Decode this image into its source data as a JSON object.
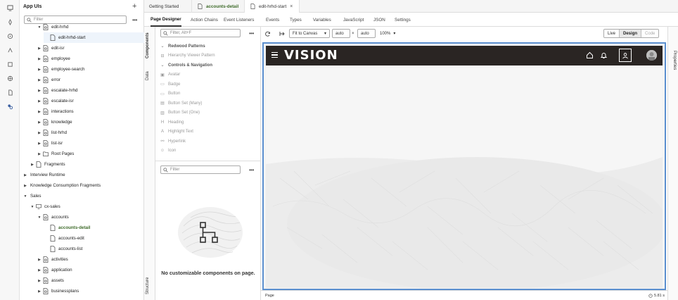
{
  "navigator": {
    "title": "App UIs",
    "filter_placeholder": "Filter",
    "tree": [
      {
        "label": "edit-hrhd",
        "depth": 3,
        "caret": "open",
        "icon": "flow"
      },
      {
        "label": "edit-hrhd-start",
        "depth": 4,
        "caret": "none",
        "icon": "page",
        "selected": true
      },
      {
        "label": "edit-isr",
        "depth": 3,
        "caret": "closed",
        "icon": "flow"
      },
      {
        "label": "employee",
        "depth": 3,
        "caret": "closed",
        "icon": "flow"
      },
      {
        "label": "employee-search",
        "depth": 3,
        "caret": "closed",
        "icon": "flow"
      },
      {
        "label": "error",
        "depth": 3,
        "caret": "closed",
        "icon": "flow"
      },
      {
        "label": "escalate-hrhd",
        "depth": 3,
        "caret": "closed",
        "icon": "flow"
      },
      {
        "label": "escalate-isr",
        "depth": 3,
        "caret": "closed",
        "icon": "flow"
      },
      {
        "label": "interactions",
        "depth": 3,
        "caret": "closed",
        "icon": "flow"
      },
      {
        "label": "knowledge",
        "depth": 3,
        "caret": "closed",
        "icon": "flow"
      },
      {
        "label": "list-hrhd",
        "depth": 3,
        "caret": "closed",
        "icon": "flow"
      },
      {
        "label": "list-isr",
        "depth": 3,
        "caret": "closed",
        "icon": "flow"
      },
      {
        "label": "Root Pages",
        "depth": 3,
        "caret": "closed",
        "icon": "folder"
      },
      {
        "label": "Fragments",
        "depth": 2,
        "caret": "closed",
        "icon": "page"
      },
      {
        "label": "Interview Runtime",
        "depth": 1,
        "caret": "closed",
        "icon": "none"
      },
      {
        "label": "Knowledge Consumption Fragments",
        "depth": 1,
        "caret": "closed",
        "icon": "none"
      },
      {
        "label": "Sales",
        "depth": 1,
        "caret": "open",
        "icon": "none"
      },
      {
        "label": "cx-sales",
        "depth": 2,
        "caret": "open",
        "icon": "app"
      },
      {
        "label": "accounts",
        "depth": 3,
        "caret": "open",
        "icon": "flow"
      },
      {
        "label": "accounts-detail",
        "depth": 4,
        "caret": "none",
        "icon": "page",
        "active": true
      },
      {
        "label": "accounts-edit",
        "depth": 4,
        "caret": "none",
        "icon": "page"
      },
      {
        "label": "accounts-list",
        "depth": 4,
        "caret": "none",
        "icon": "page"
      },
      {
        "label": "activities",
        "depth": 3,
        "caret": "closed",
        "icon": "flow"
      },
      {
        "label": "application",
        "depth": 3,
        "caret": "closed",
        "icon": "flow"
      },
      {
        "label": "assets",
        "depth": 3,
        "caret": "closed",
        "icon": "flow"
      },
      {
        "label": "businessplans",
        "depth": 3,
        "caret": "closed",
        "icon": "flow"
      }
    ]
  },
  "tabs": [
    {
      "label": "Getting Started",
      "icon": "none"
    },
    {
      "label": "accounts-detail",
      "icon": "page",
      "style": "active-link"
    },
    {
      "label": "edit-hrhd-start",
      "icon": "page",
      "active": true,
      "closable": true
    }
  ],
  "subtabs": [
    "Page Designer",
    "Action Chains",
    "Event Listeners",
    "Events",
    "Types",
    "Variables",
    "JavaScript",
    "JSON",
    "Settings"
  ],
  "side_labels": {
    "components": "Components",
    "data": "Data",
    "structure": "Structure",
    "properties": "Properties"
  },
  "components": {
    "filter_placeholder": "Filter, Alt+F",
    "items": [
      {
        "label": "Redwood Patterns",
        "group": true
      },
      {
        "label": "Hierarchy Viewer Pattern",
        "icon": "H"
      },
      {
        "label": "Controls & Navigation",
        "group": true
      },
      {
        "label": "Avatar",
        "icon": "A"
      },
      {
        "label": "Badge",
        "icon": "B"
      },
      {
        "label": "Button",
        "icon": "btn"
      },
      {
        "label": "Button Set (Many)",
        "icon": "bsm"
      },
      {
        "label": "Button Set (One)",
        "icon": "bso"
      },
      {
        "label": "Heading",
        "icon": "Hd"
      },
      {
        "label": "Highlight Text",
        "icon": "Ht"
      },
      {
        "label": "Hyperlink",
        "icon": "lnk"
      },
      {
        "label": "Icon",
        "icon": "ico"
      }
    ],
    "structure_filter_placeholder": "Filter",
    "empty_message": "No customizable components on page."
  },
  "toolbar": {
    "fit_label": "Fit to Canvas",
    "width_value": "auto",
    "height_value": "auto",
    "times": "×",
    "zoom": "100%",
    "modes": [
      "Live",
      "Design",
      "Code"
    ],
    "active_mode": "Design"
  },
  "canvas": {
    "logo_text": "VISION"
  },
  "status": {
    "left": "Page",
    "right": "5.81 s"
  }
}
